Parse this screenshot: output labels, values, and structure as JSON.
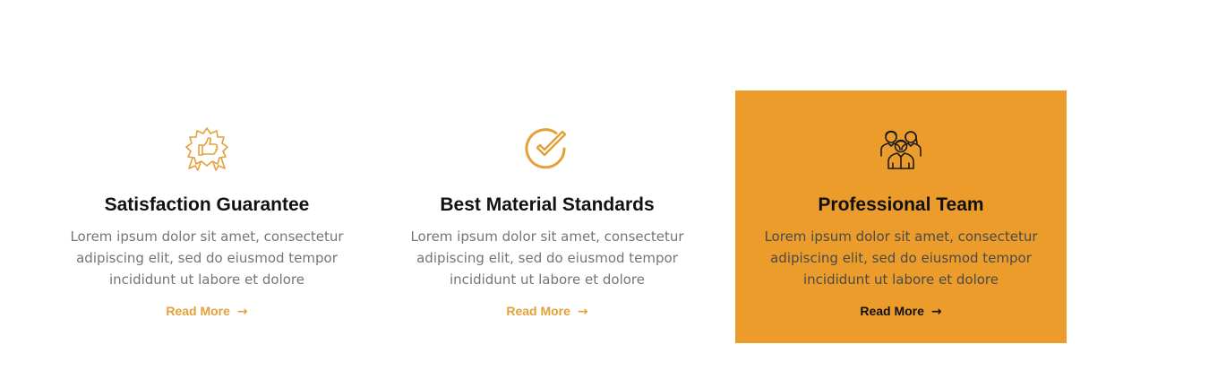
{
  "colors": {
    "accent": "#eb9c2a",
    "link": "#e4a13a",
    "title": "#111111",
    "text": "#757575"
  },
  "features": [
    {
      "icon": "thumbs-up-badge-icon",
      "title": "Satisfaction Guarantee",
      "text": "Lorem ipsum dolor sit amet, consectetur adipiscing elit, sed do eiusmod tempor incididunt ut labore et dolore",
      "link_label": "Read More",
      "link_icon": "arrow-right-icon",
      "active": false
    },
    {
      "icon": "check-circle-icon",
      "title": "Best Material Standards",
      "text": "Lorem ipsum dolor sit amet, consectetur adipiscing elit, sed do eiusmod tempor incididunt ut labore et dolore",
      "link_label": "Read More",
      "link_icon": "arrow-right-icon",
      "active": false
    },
    {
      "icon": "team-icon",
      "title": "Professional Team",
      "text": "Lorem ipsum dolor sit amet, consectetur adipiscing elit, sed do eiusmod tempor incididunt ut labore et dolore",
      "link_label": "Read More",
      "link_icon": "arrow-right-icon",
      "active": true
    }
  ]
}
